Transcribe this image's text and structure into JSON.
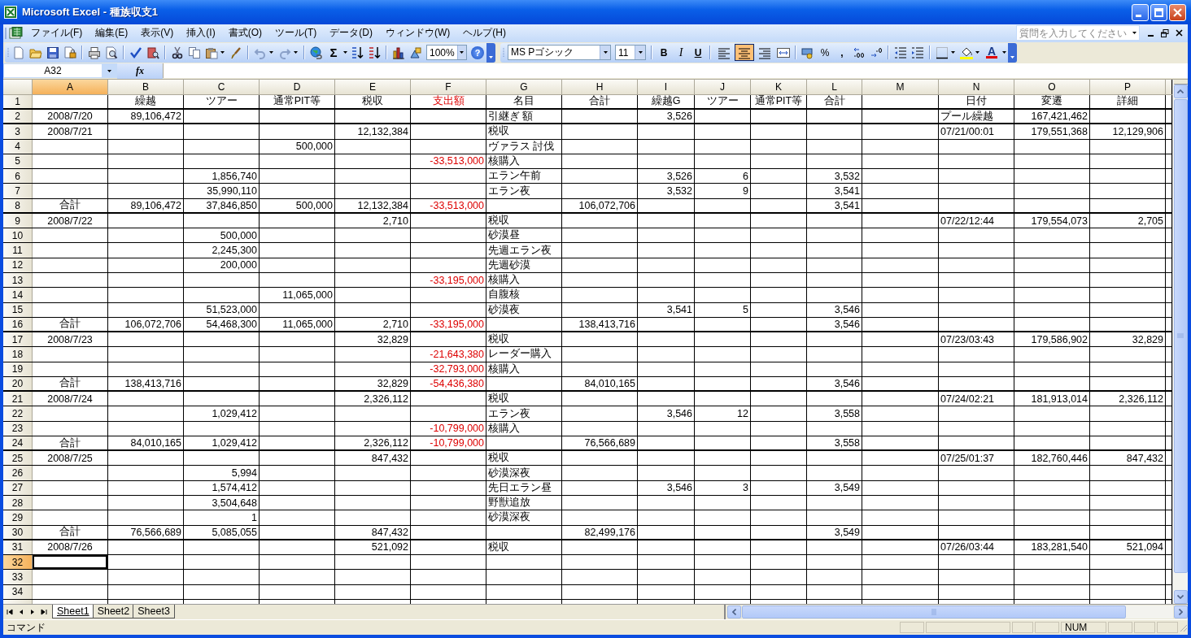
{
  "window": {
    "title": "Microsoft Excel - 種族収支1"
  },
  "menu": [
    {
      "label": "ファイル(F)"
    },
    {
      "label": "編集(E)"
    },
    {
      "label": "表示(V)"
    },
    {
      "label": "挿入(I)"
    },
    {
      "label": "書式(O)"
    },
    {
      "label": "ツール(T)"
    },
    {
      "label": "データ(D)"
    },
    {
      "label": "ウィンドウ(W)"
    },
    {
      "label": "ヘルプ(H)"
    }
  ],
  "help_field": {
    "placeholder": "質問を入力してください"
  },
  "standard_toolbar": {
    "autosum": "Σ",
    "zoom": "100%",
    "help": "?"
  },
  "formatting_toolbar": {
    "font": "MS Pゴシック",
    "size": "11",
    "bold": "B",
    "italic": "I",
    "underline": "U",
    "align_buttons": [
      {
        "selected": false
      },
      {
        "selected": true
      },
      {
        "selected": false
      }
    ],
    "percent": "%",
    "comma": ",",
    "font_color": "A"
  },
  "formula_bar": {
    "name_box": "A32",
    "fx": "fx"
  },
  "columns": [
    {
      "label": "A",
      "selected": true
    },
    {
      "label": "B",
      "selected": false
    },
    {
      "label": "C",
      "selected": false
    },
    {
      "label": "D",
      "selected": false
    },
    {
      "label": "E",
      "selected": false
    },
    {
      "label": "F",
      "selected": false
    },
    {
      "label": "G",
      "selected": false
    },
    {
      "label": "H",
      "selected": false
    },
    {
      "label": "I",
      "selected": false
    },
    {
      "label": "J",
      "selected": false
    },
    {
      "label": "K",
      "selected": false
    },
    {
      "label": "L",
      "selected": false
    },
    {
      "label": "M",
      "selected": false
    },
    {
      "label": "N",
      "selected": false
    },
    {
      "label": "O",
      "selected": false
    },
    {
      "label": "P",
      "selected": false
    }
  ],
  "rows": [
    {
      "number": "1",
      "kind": "header",
      "selected": false,
      "group_end": true,
      "cells": {
        "B": {
          "text": "繰越",
          "red": false
        },
        "C": {
          "text": "ツアー",
          "red": false
        },
        "D": {
          "text": "通常PIT等",
          "red": false
        },
        "E": {
          "text": "税収",
          "red": false
        },
        "F": {
          "text": "支出額",
          "red": true
        },
        "G": {
          "text": "名目",
          "red": false
        },
        "H": {
          "text": "合計",
          "red": false
        },
        "I": {
          "text": "繰越G",
          "red": false
        },
        "J": {
          "text": "ツアー",
          "red": false
        },
        "K": {
          "text": "通常PIT等",
          "red": false
        },
        "L": {
          "text": "合計",
          "red": false
        },
        "N": {
          "text": "日付",
          "red": false
        },
        "O": {
          "text": "変遷",
          "red": false
        },
        "P": {
          "text": "詳細",
          "red": false
        }
      }
    },
    {
      "number": "2",
      "kind": "data",
      "selected": false,
      "group_end": true,
      "cells": {
        "A": {
          "text": "2008/7/20",
          "red": false
        },
        "B": {
          "text": "89,106,472",
          "red": false
        },
        "G": {
          "text": "引継ぎ 額",
          "red": false
        },
        "I": {
          "text": "3,526",
          "red": false
        },
        "N": {
          "text": "プール繰越",
          "red": false
        },
        "O": {
          "text": "167,421,462",
          "red": false
        }
      }
    },
    {
      "number": "3",
      "kind": "data",
      "selected": false,
      "group_end": false,
      "cells": {
        "A": {
          "text": "2008/7/21",
          "red": false
        },
        "E": {
          "text": "12,132,384",
          "red": false
        },
        "G": {
          "text": "税収",
          "red": false
        },
        "N": {
          "text": "07/21/00:01",
          "red": false
        },
        "O": {
          "text": "179,551,368",
          "red": false
        },
        "P": {
          "text": "12,129,906",
          "red": false
        }
      }
    },
    {
      "number": "4",
      "kind": "data",
      "selected": false,
      "group_end": false,
      "cells": {
        "D": {
          "text": "500,000",
          "red": false
        },
        "G": {
          "text": "ヴァラス 討伐",
          "red": false
        }
      }
    },
    {
      "number": "5",
      "kind": "data",
      "selected": false,
      "group_end": false,
      "cells": {
        "F": {
          "text": "-33,513,000",
          "red": true
        },
        "G": {
          "text": "核購入",
          "red": false
        }
      }
    },
    {
      "number": "6",
      "kind": "data",
      "selected": false,
      "group_end": false,
      "cells": {
        "C": {
          "text": "1,856,740",
          "red": false
        },
        "G": {
          "text": "エラン午前",
          "red": false
        },
        "I": {
          "text": "3,526",
          "red": false
        },
        "J": {
          "text": "6",
          "red": false
        },
        "L": {
          "text": "3,532",
          "red": false
        }
      }
    },
    {
      "number": "7",
      "kind": "data",
      "selected": false,
      "group_end": false,
      "cells": {
        "C": {
          "text": "35,990,110",
          "red": false
        },
        "G": {
          "text": "エラン夜",
          "red": false
        },
        "I": {
          "text": "3,532",
          "red": false
        },
        "J": {
          "text": "9",
          "red": false
        },
        "L": {
          "text": "3,541",
          "red": false
        }
      }
    },
    {
      "number": "8",
      "kind": "data",
      "selected": false,
      "group_end": true,
      "cells": {
        "A": {
          "text": "合計",
          "red": false
        },
        "B": {
          "text": "89,106,472",
          "red": false
        },
        "C": {
          "text": "37,846,850",
          "red": false
        },
        "D": {
          "text": "500,000",
          "red": false
        },
        "E": {
          "text": "12,132,384",
          "red": false
        },
        "F": {
          "text": "-33,513,000",
          "red": true
        },
        "H": {
          "text": "106,072,706",
          "red": false
        },
        "L": {
          "text": "3,541",
          "red": false
        }
      }
    },
    {
      "number": "9",
      "kind": "data",
      "selected": false,
      "group_end": false,
      "cells": {
        "A": {
          "text": "2008/7/22",
          "red": false
        },
        "E": {
          "text": "2,710",
          "red": false
        },
        "G": {
          "text": "税収",
          "red": false
        },
        "N": {
          "text": "07/22/12:44",
          "red": false
        },
        "O": {
          "text": "179,554,073",
          "red": false
        },
        "P": {
          "text": "2,705",
          "red": false
        }
      }
    },
    {
      "number": "10",
      "kind": "data",
      "selected": false,
      "group_end": false,
      "cells": {
        "C": {
          "text": "500,000",
          "red": false
        },
        "G": {
          "text": "砂漠昼",
          "red": false
        }
      }
    },
    {
      "number": "11",
      "kind": "data",
      "selected": false,
      "group_end": false,
      "cells": {
        "C": {
          "text": "2,245,300",
          "red": false
        },
        "G": {
          "text": "先週エラン夜",
          "red": false
        }
      }
    },
    {
      "number": "12",
      "kind": "data",
      "selected": false,
      "group_end": false,
      "cells": {
        "C": {
          "text": "200,000",
          "red": false
        },
        "G": {
          "text": "先週砂漠",
          "red": false
        }
      }
    },
    {
      "number": "13",
      "kind": "data",
      "selected": false,
      "group_end": false,
      "cells": {
        "F": {
          "text": "-33,195,000",
          "red": true
        },
        "G": {
          "text": "核購入",
          "red": false
        }
      }
    },
    {
      "number": "14",
      "kind": "data",
      "selected": false,
      "group_end": false,
      "cells": {
        "D": {
          "text": "11,065,000",
          "red": false
        },
        "G": {
          "text": "自腹核",
          "red": false
        }
      }
    },
    {
      "number": "15",
      "kind": "data",
      "selected": false,
      "group_end": false,
      "cells": {
        "C": {
          "text": "51,523,000",
          "red": false
        },
        "G": {
          "text": "砂漠夜",
          "red": false
        },
        "I": {
          "text": "3,541",
          "red": false
        },
        "J": {
          "text": "5",
          "red": false
        },
        "L": {
          "text": "3,546",
          "red": false
        }
      }
    },
    {
      "number": "16",
      "kind": "data",
      "selected": false,
      "group_end": true,
      "cells": {
        "A": {
          "text": "合計",
          "red": false
        },
        "B": {
          "text": "106,072,706",
          "red": false
        },
        "C": {
          "text": "54,468,300",
          "red": false
        },
        "D": {
          "text": "11,065,000",
          "red": false
        },
        "E": {
          "text": "2,710",
          "red": false
        },
        "F": {
          "text": "-33,195,000",
          "red": true
        },
        "H": {
          "text": "138,413,716",
          "red": false
        },
        "L": {
          "text": "3,546",
          "red": false
        }
      }
    },
    {
      "number": "17",
      "kind": "data",
      "selected": false,
      "group_end": false,
      "cells": {
        "A": {
          "text": "2008/7/23",
          "red": false
        },
        "E": {
          "text": "32,829",
          "red": false
        },
        "G": {
          "text": "税収",
          "red": false
        },
        "N": {
          "text": "07/23/03:43",
          "red": false
        },
        "O": {
          "text": "179,586,902",
          "red": false
        },
        "P": {
          "text": "32,829",
          "red": false
        }
      }
    },
    {
      "number": "18",
      "kind": "data",
      "selected": false,
      "group_end": false,
      "cells": {
        "F": {
          "text": "-21,643,380",
          "red": true
        },
        "G": {
          "text": "レーダー購入",
          "red": false
        }
      }
    },
    {
      "number": "19",
      "kind": "data",
      "selected": false,
      "group_end": false,
      "cells": {
        "F": {
          "text": "-32,793,000",
          "red": true
        },
        "G": {
          "text": "核購入",
          "red": false
        }
      }
    },
    {
      "number": "20",
      "kind": "data",
      "selected": false,
      "group_end": true,
      "cells": {
        "A": {
          "text": "合計",
          "red": false
        },
        "B": {
          "text": "138,413,716",
          "red": false
        },
        "E": {
          "text": "32,829",
          "red": false
        },
        "F": {
          "text": "-54,436,380",
          "red": true
        },
        "H": {
          "text": "84,010,165",
          "red": false
        },
        "L": {
          "text": "3,546",
          "red": false
        }
      }
    },
    {
      "number": "21",
      "kind": "data",
      "selected": false,
      "group_end": false,
      "cells": {
        "A": {
          "text": "2008/7/24",
          "red": false
        },
        "E": {
          "text": "2,326,112",
          "red": false
        },
        "G": {
          "text": "税収",
          "red": false
        },
        "N": {
          "text": "07/24/02:21",
          "red": false
        },
        "O": {
          "text": "181,913,014",
          "red": false
        },
        "P": {
          "text": "2,326,112",
          "red": false
        }
      }
    },
    {
      "number": "22",
      "kind": "data",
      "selected": false,
      "group_end": false,
      "cells": {
        "C": {
          "text": "1,029,412",
          "red": false
        },
        "G": {
          "text": "エラン夜",
          "red": false
        },
        "I": {
          "text": "3,546",
          "red": false
        },
        "J": {
          "text": "12",
          "red": false
        },
        "L": {
          "text": "3,558",
          "red": false
        }
      }
    },
    {
      "number": "23",
      "kind": "data",
      "selected": false,
      "group_end": false,
      "cells": {
        "F": {
          "text": "-10,799,000",
          "red": true
        },
        "G": {
          "text": "核購入",
          "red": false
        }
      }
    },
    {
      "number": "24",
      "kind": "data",
      "selected": false,
      "group_end": true,
      "cells": {
        "A": {
          "text": "合計",
          "red": false
        },
        "B": {
          "text": "84,010,165",
          "red": false
        },
        "C": {
          "text": "1,029,412",
          "red": false
        },
        "E": {
          "text": "2,326,112",
          "red": false
        },
        "F": {
          "text": "-10,799,000",
          "red": true
        },
        "H": {
          "text": "76,566,689",
          "red": false
        },
        "L": {
          "text": "3,558",
          "red": false
        }
      }
    },
    {
      "number": "25",
      "kind": "data",
      "selected": false,
      "group_end": false,
      "cells": {
        "A": {
          "text": "2008/7/25",
          "red": false
        },
        "E": {
          "text": "847,432",
          "red": false
        },
        "G": {
          "text": "税収",
          "red": false
        },
        "N": {
          "text": "07/25/01:37",
          "red": false
        },
        "O": {
          "text": "182,760,446",
          "red": false
        },
        "P": {
          "text": "847,432",
          "red": false
        }
      }
    },
    {
      "number": "26",
      "kind": "data",
      "selected": false,
      "group_end": false,
      "cells": {
        "C": {
          "text": "5,994",
          "red": false
        },
        "G": {
          "text": "砂漠深夜",
          "red": false
        }
      }
    },
    {
      "number": "27",
      "kind": "data",
      "selected": false,
      "group_end": false,
      "cells": {
        "C": {
          "text": "1,574,412",
          "red": false
        },
        "G": {
          "text": "先日エラン昼",
          "red": false
        },
        "I": {
          "text": "3,546",
          "red": false
        },
        "J": {
          "text": "3",
          "red": false
        },
        "L": {
          "text": "3,549",
          "red": false
        }
      }
    },
    {
      "number": "28",
      "kind": "data",
      "selected": false,
      "group_end": false,
      "cells": {
        "C": {
          "text": "3,504,648",
          "red": false
        },
        "G": {
          "text": "野獣追放",
          "red": false
        }
      }
    },
    {
      "number": "29",
      "kind": "data",
      "selected": false,
      "group_end": false,
      "cells": {
        "C": {
          "text": "1",
          "red": false
        },
        "G": {
          "text": "砂漠深夜",
          "red": false
        }
      }
    },
    {
      "number": "30",
      "kind": "data",
      "selected": false,
      "group_end": true,
      "cells": {
        "A": {
          "text": "合計",
          "red": false
        },
        "B": {
          "text": "76,566,689",
          "red": false
        },
        "C": {
          "text": "5,085,055",
          "red": false
        },
        "E": {
          "text": "847,432",
          "red": false
        },
        "H": {
          "text": "82,499,176",
          "red": false
        },
        "L": {
          "text": "3,549",
          "red": false
        }
      }
    },
    {
      "number": "31",
      "kind": "data",
      "selected": false,
      "group_end": false,
      "cells": {
        "A": {
          "text": "2008/7/26",
          "red": false
        },
        "E": {
          "text": "521,092",
          "red": false
        },
        "G": {
          "text": "税収",
          "red": false
        },
        "N": {
          "text": "07/26/03:44",
          "red": false
        },
        "O": {
          "text": "183,281,540",
          "red": false
        },
        "P": {
          "text": "521,094",
          "red": false
        }
      }
    },
    {
      "number": "32",
      "kind": "data",
      "selected": true,
      "group_end": false
    },
    {
      "number": "33",
      "kind": "data",
      "selected": false,
      "group_end": false
    },
    {
      "number": "34",
      "kind": "data",
      "selected": false,
      "group_end": false
    }
  ],
  "sheet_tabs": [
    {
      "label": "Sheet1",
      "selected": true
    },
    {
      "label": "Sheet2",
      "selected": false
    },
    {
      "label": "Sheet3",
      "selected": false
    }
  ],
  "status_bar": {
    "mode": "コマンド",
    "indicator": "NUM"
  }
}
